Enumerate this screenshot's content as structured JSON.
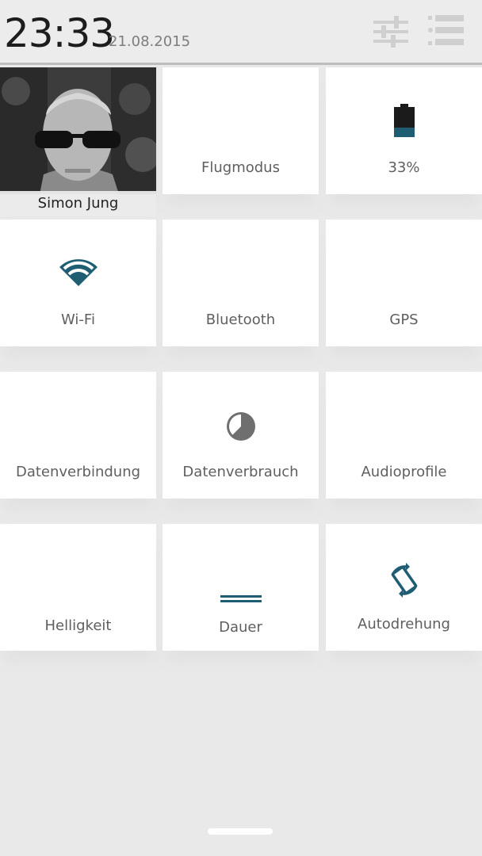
{
  "status": {
    "time": "23:33",
    "date": "21.08.2015"
  },
  "header_icons": {
    "settings": "sliders-icon",
    "edit": "list-edit-icon"
  },
  "profile": {
    "name": "Simon Jung"
  },
  "tiles": [
    {
      "label": "Flugmodus"
    },
    {
      "label": "33%",
      "icon": "battery-icon",
      "level": 0.33
    },
    {
      "label": "Wi-Fi",
      "icon": "wifi-icon"
    },
    {
      "label": "Bluetooth"
    },
    {
      "label": "GPS"
    },
    {
      "label": "Datenverbindung"
    },
    {
      "label": "Datenverbrauch",
      "icon": "data-usage-icon"
    },
    {
      "label": "Audioprofile"
    },
    {
      "label": "Helligkeit"
    },
    {
      "label": "Dauer",
      "icon": "timeout-bar-icon"
    },
    {
      "label": "Autodrehung",
      "icon": "rotate-icon"
    }
  ],
  "colors": {
    "accent": "#1f5d73",
    "icon_gray": "#6f6f6f",
    "tile": "#ffffff",
    "background": "#e9e9e9"
  }
}
